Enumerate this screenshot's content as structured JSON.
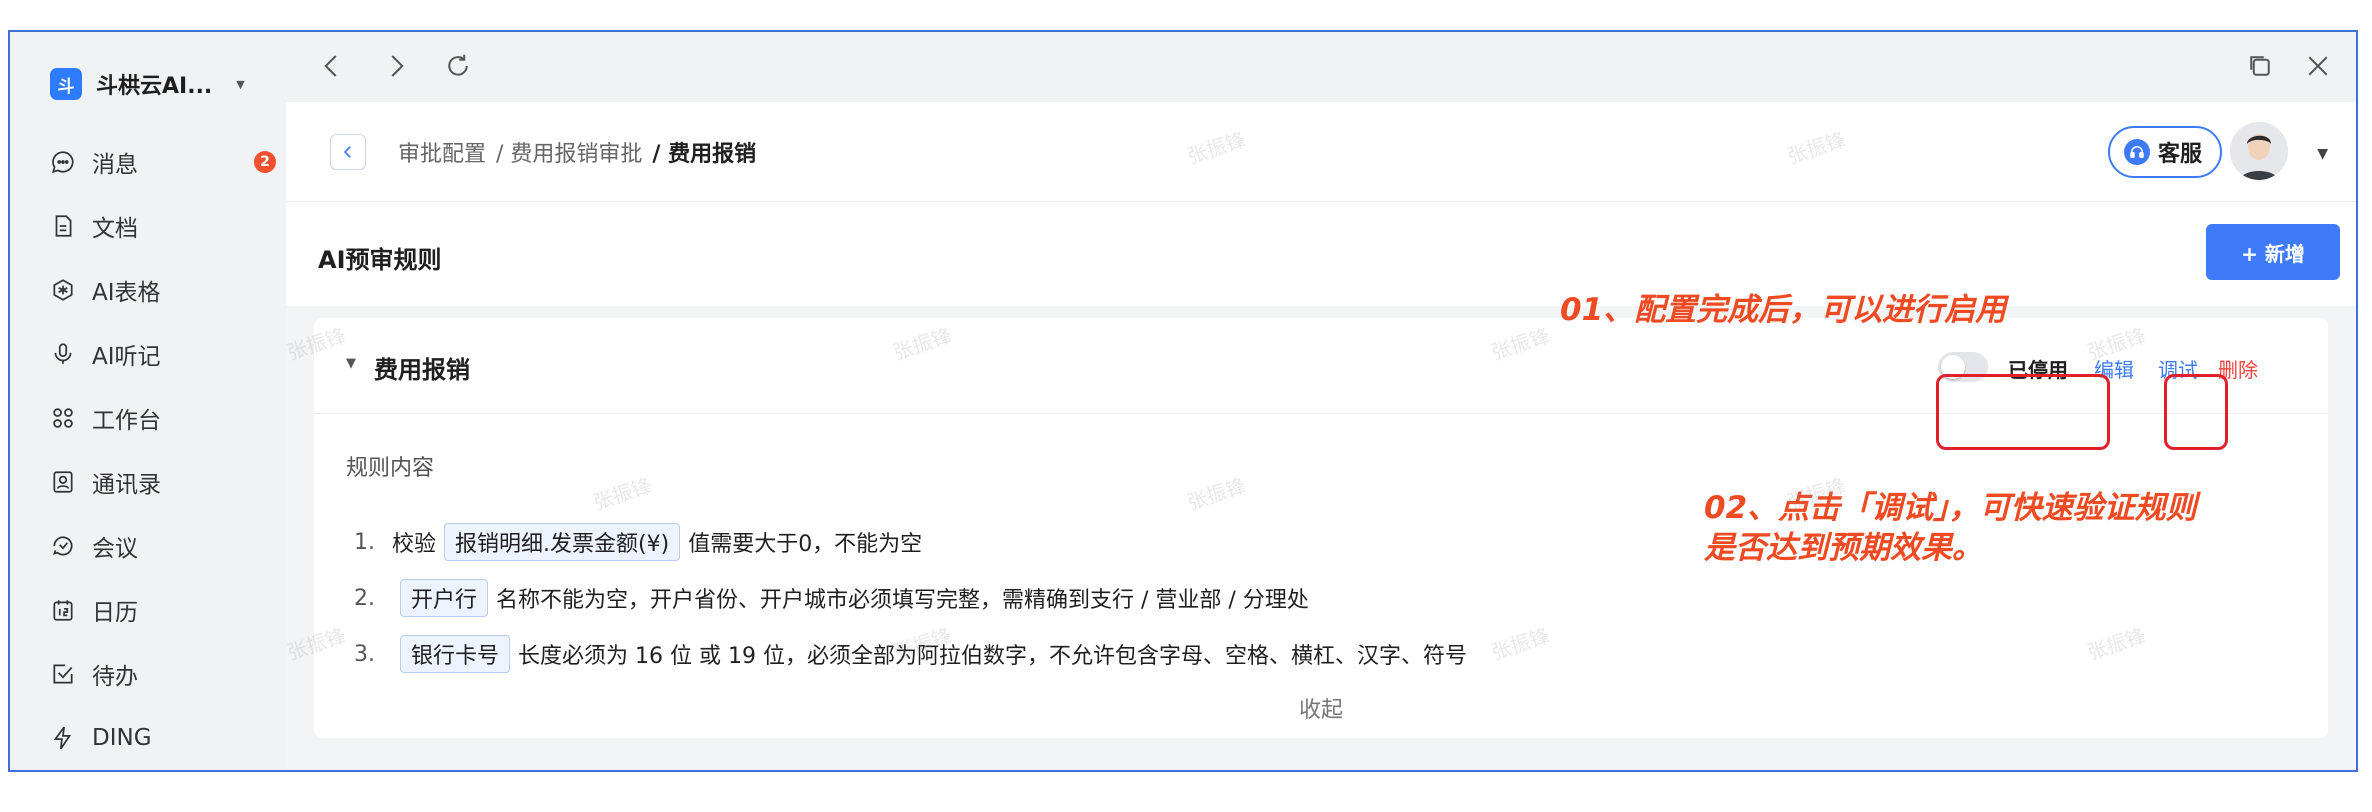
{
  "org": {
    "logo_char": "斗",
    "name": "斗栱云AI..."
  },
  "sidebar": {
    "items": [
      {
        "label": "消息",
        "icon": "chat-bubble-icon",
        "badge": "2"
      },
      {
        "label": "文档",
        "icon": "document-icon"
      },
      {
        "label": "AI表格",
        "icon": "ai-table-icon"
      },
      {
        "label": "AI听记",
        "icon": "ai-recorder-icon"
      },
      {
        "label": "工作台",
        "icon": "grid-icon"
      },
      {
        "label": "通讯录",
        "icon": "contacts-icon"
      },
      {
        "label": "会议",
        "icon": "meeting-icon"
      },
      {
        "label": "日历",
        "icon": "calendar-icon"
      },
      {
        "label": "待办",
        "icon": "todo-icon"
      },
      {
        "label": "DING",
        "icon": "lightning-icon"
      }
    ]
  },
  "breadcrumb": {
    "items": [
      "审批配置",
      "/ 费用报销审批"
    ],
    "current": "/ 费用报销"
  },
  "header": {
    "service_label": "客服"
  },
  "section": {
    "title": "AI预审规则",
    "new_label": "+ 新增"
  },
  "card": {
    "title": "费用报销",
    "status": "已停用",
    "toggle_on": false,
    "actions": {
      "edit": "编辑",
      "debug": "调试",
      "delete": "删除"
    },
    "rule_label": "规则内容",
    "rules": [
      {
        "no": "1.",
        "prefix": "校验",
        "tag": "报销明细.发票金额(¥)",
        "text": "值需要大于0，不能为空"
      },
      {
        "no": "2.",
        "prefix": "",
        "tag": "开户行",
        "text": "名称不能为空，开户省份、开户城市必须填写完整，需精确到支行 / 营业部 / 分理处"
      },
      {
        "no": "3.",
        "prefix": "",
        "tag": "银行卡号",
        "text": "长度必须为 16 位 或 19 位，必须全部为阿拉伯数字，不允许包含字母、空格、横杠、汉字、符号"
      }
    ],
    "collapse_label": "收起"
  },
  "annotations": {
    "a1": "01、配置完成后，可以进行启用",
    "a2_line1": "02、点击「调试」，可快速验证规则",
    "a2_line2": "是否达到预期效果。"
  },
  "watermark": "张振锋",
  "colors": {
    "accent": "#3d7bfa",
    "danger": "#f0433b",
    "annotation": "#ef4a21",
    "highlight_box": "#e0202a"
  }
}
